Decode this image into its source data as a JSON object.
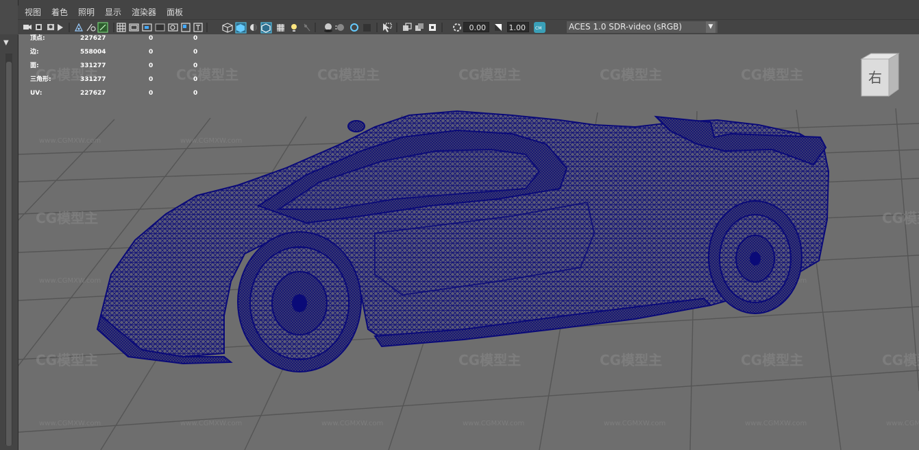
{
  "menu": [
    "视图",
    "着色",
    "照明",
    "显示",
    "渲染器",
    "面板"
  ],
  "toolbar": {
    "exposure_value": "0.00",
    "gamma_value": "1.00",
    "color_space": "ACES 1.0 SDR-video (sRGB)"
  },
  "stats": {
    "rows": [
      {
        "label": "顶点:",
        "v1": "227627",
        "v2": "0",
        "v3": "0"
      },
      {
        "label": "边:",
        "v1": "558004",
        "v2": "0",
        "v3": "0"
      },
      {
        "label": "面:",
        "v1": "331277",
        "v2": "0",
        "v3": "0"
      },
      {
        "label": "三角形:",
        "v1": "331277",
        "v2": "0",
        "v3": "0"
      },
      {
        "label": "UV:",
        "v1": "227627",
        "v2": "0",
        "v3": "0"
      }
    ]
  },
  "viewcube": {
    "face_label": "右"
  },
  "watermark": {
    "logo_text": "CG模型主",
    "url_text": "www.CGMXW.com"
  },
  "colors": {
    "wireframe": "#0a0a78",
    "viewport_bg": "#6e6e6e",
    "grid": "#555555",
    "ui_bg": "#444444"
  }
}
